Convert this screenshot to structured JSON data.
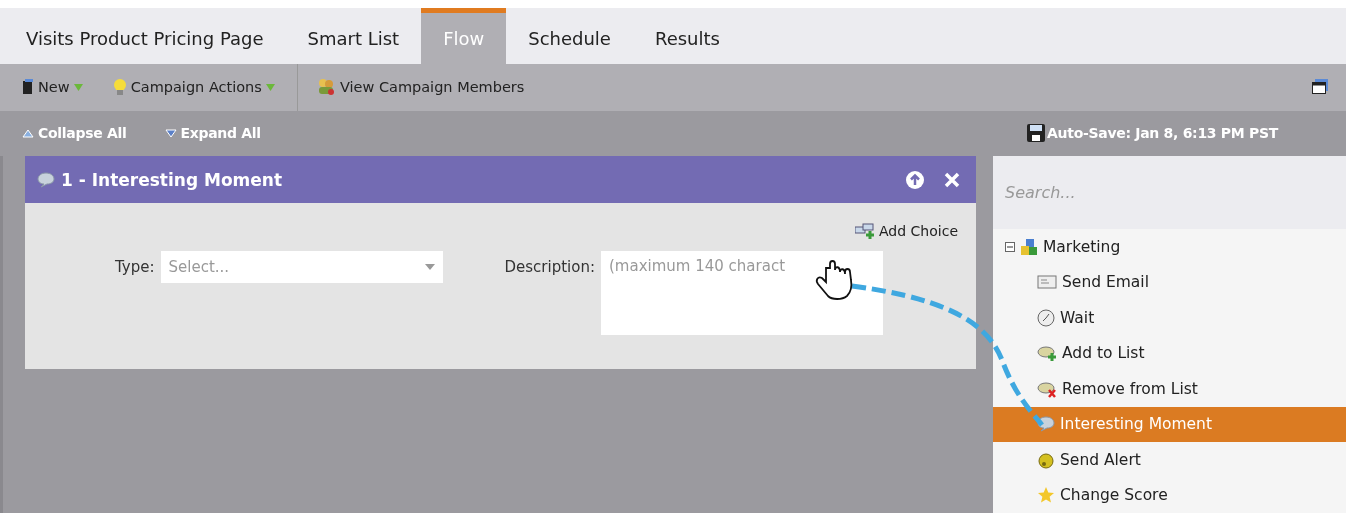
{
  "tabs": [
    {
      "label": "Visits Product Pricing Page",
      "selected": false
    },
    {
      "label": "Smart List",
      "selected": false
    },
    {
      "label": "Flow",
      "selected": true
    },
    {
      "label": "Schedule",
      "selected": false
    },
    {
      "label": "Results",
      "selected": false
    }
  ],
  "toolbar": [
    {
      "kind": "new",
      "label": "New",
      "dropdown": true
    },
    {
      "kind": "actions",
      "label": "Campaign Actions",
      "dropdown": true
    },
    {
      "kind": "members",
      "label": "View Campaign Members",
      "dropdown": false
    }
  ],
  "subbar": {
    "collapse": "Collapse All",
    "expand": "Expand All",
    "autosave": "Auto-Save: Jan 8, 6:13 PM PST"
  },
  "step": {
    "title": "1 - Interesting Moment",
    "add_choice": "Add Choice",
    "type_label": "Type:",
    "type_placeholder": "Select...",
    "description_label": "Description:",
    "description_placeholder": "(maximum 140 charact"
  },
  "palette": {
    "search_placeholder": "Search...",
    "tree": [
      {
        "label": "Marketing",
        "kind": "folder",
        "expanded": true,
        "selected": false,
        "children": [
          {
            "label": "Send Email",
            "kind": "email",
            "selected": false
          },
          {
            "label": "Wait",
            "kind": "clock",
            "selected": false
          },
          {
            "label": "Add to List",
            "kind": "add",
            "selected": false
          },
          {
            "label": "Remove from List",
            "kind": "remove",
            "selected": false
          },
          {
            "label": "Interesting Moment",
            "kind": "bubble",
            "selected": true
          },
          {
            "label": "Send Alert",
            "kind": "bell",
            "selected": false
          },
          {
            "label": "Change Score",
            "kind": "star",
            "selected": false
          }
        ]
      }
    ]
  }
}
